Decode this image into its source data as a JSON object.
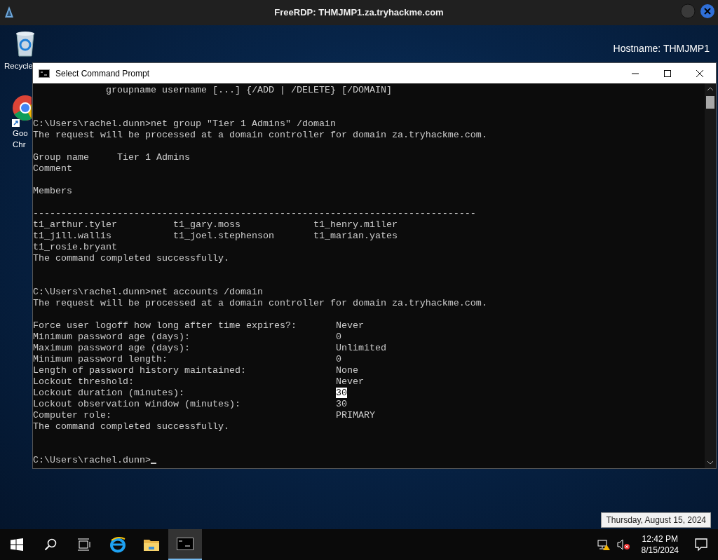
{
  "rdp_bar": {
    "title": "FreeRDP: THMJMP1.za.tryhackme.com"
  },
  "desktop": {
    "icons": [
      {
        "kind": "recycle",
        "label": [
          "Recycle"
        ]
      },
      {
        "kind": "chrome",
        "label": [
          "Goo",
          "Chr"
        ]
      }
    ],
    "info": [
      "Hostname: THMJMP1"
    ]
  },
  "window": {
    "title": "Select Command Prompt",
    "lines": [
      {
        "kind": "text",
        "text": "             groupname username [...] {/ADD | /DELETE} [/DOMAIN]"
      },
      {
        "kind": "blank"
      },
      {
        "kind": "blank"
      },
      {
        "kind": "text",
        "text": "C:\\Users\\rachel.dunn>net group \"Tier 1 Admins\" /domain"
      },
      {
        "kind": "text",
        "text": "The request will be processed at a domain controller for domain za.tryhackme.com."
      },
      {
        "kind": "blank"
      },
      {
        "kind": "text",
        "text": "Group name     Tier 1 Admins"
      },
      {
        "kind": "text",
        "text": "Comment"
      },
      {
        "kind": "blank"
      },
      {
        "kind": "text",
        "text": "Members"
      },
      {
        "kind": "blank"
      },
      {
        "kind": "text",
        "text": "-------------------------------------------------------------------------------"
      },
      {
        "kind": "text",
        "text": "t1_arthur.tyler          t1_gary.moss             t1_henry.miller"
      },
      {
        "kind": "text",
        "text": "t1_jill.wallis           t1_joel.stephenson       t1_marian.yates"
      },
      {
        "kind": "text",
        "text": "t1_rosie.bryant"
      },
      {
        "kind": "text",
        "text": "The command completed successfully."
      },
      {
        "kind": "blank"
      },
      {
        "kind": "blank"
      },
      {
        "kind": "text",
        "text": "C:\\Users\\rachel.dunn>net accounts /domain"
      },
      {
        "kind": "text",
        "text": "The request will be processed at a domain controller for domain za.tryhackme.com."
      },
      {
        "kind": "blank"
      },
      {
        "kind": "text",
        "text": "Force user logoff how long after time expires?:       Never"
      },
      {
        "kind": "text",
        "text": "Minimum password age (days):                          0"
      },
      {
        "kind": "text",
        "text": "Maximum password age (days):                          Unlimited"
      },
      {
        "kind": "text",
        "text": "Minimum password length:                              0"
      },
      {
        "kind": "text",
        "text": "Length of password history maintained:                None"
      },
      {
        "kind": "text",
        "text": "Lockout threshold:                                    Never"
      },
      {
        "kind": "text",
        "text": "Lockout duration (minutes):                           ",
        "selected_text": "30"
      },
      {
        "kind": "text",
        "text": "Lockout observation window (minutes):                 30"
      },
      {
        "kind": "text",
        "text": "Computer role:                                        PRIMARY"
      },
      {
        "kind": "text",
        "text": "The command completed successfully."
      },
      {
        "kind": "blank"
      },
      {
        "kind": "blank"
      },
      {
        "kind": "text",
        "text": "C:\\Users\\rachel.dunn>",
        "cursor": true
      }
    ]
  },
  "taskbar": {
    "apps": [
      {
        "kind": "start"
      },
      {
        "kind": "search"
      },
      {
        "kind": "taskview"
      },
      {
        "kind": "ie"
      },
      {
        "kind": "explorer"
      },
      {
        "kind": "cmd",
        "selected": true
      }
    ],
    "clock": {
      "time": "12:42 PM",
      "date": "8/15/2024"
    },
    "tooltip": "Thursday, August 15, 2024"
  }
}
